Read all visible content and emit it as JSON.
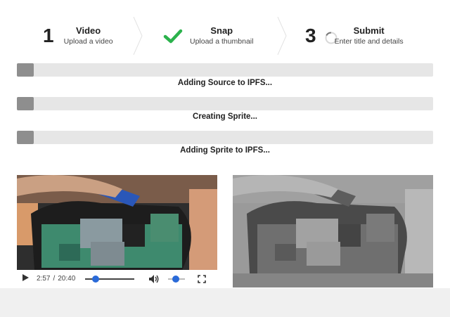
{
  "steps": [
    {
      "number": "1",
      "title": "Video",
      "subtitle": "Upload a video",
      "state": "number"
    },
    {
      "number": "",
      "title": "Snap",
      "subtitle": "Upload a thumbnail",
      "state": "done",
      "icon": "checkmark-icon"
    },
    {
      "number": "3",
      "title": "Submit",
      "subtitle": "Enter title and details",
      "state": "loading",
      "icon": "spinner-icon"
    }
  ],
  "progress": [
    {
      "label": "Adding Source to IPFS...",
      "fraction": 0.04
    },
    {
      "label": "Creating Sprite...",
      "fraction": 0.04
    },
    {
      "label": "Adding Sprite to IPFS...",
      "fraction": 0.04
    }
  ],
  "player": {
    "current_time": "2:57",
    "separator": "/",
    "duration": "20:40",
    "seek_fraction": 0.143,
    "volume_fraction": 0.45,
    "icons": [
      "play-icon",
      "volume-icon",
      "fullscreen-icon"
    ]
  },
  "colors": {
    "check": "#2bb24c",
    "bar_track": "#e6e6e6",
    "bar_fill": "#8e8e8e",
    "player_accent": "#2a6ad8"
  }
}
